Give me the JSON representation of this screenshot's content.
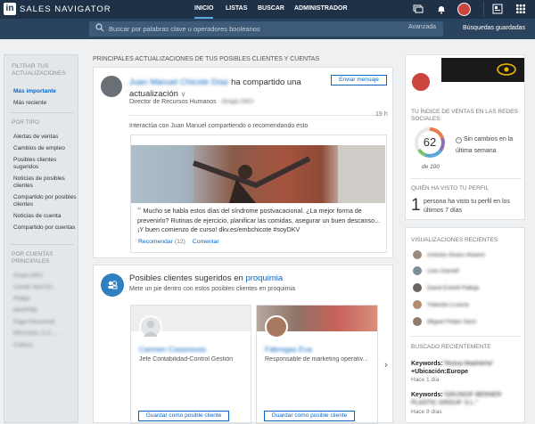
{
  "app": {
    "logo": "in",
    "brand": "SALES NAVIGATOR"
  },
  "nav": [
    {
      "label": "INICIO"
    },
    {
      "label": "LISTAS"
    },
    {
      "label": "BUSCAR"
    },
    {
      "label": "ADMINISTRADOR"
    }
  ],
  "search": {
    "placeholder": "Buscar por palabras clave u operadores booleanos",
    "advanced": "Avanzada",
    "saved": "Búsquedas guardadas"
  },
  "filters": {
    "heading": "FILTRAR TUS ACTUALIZACIONES",
    "sort": [
      "Más importante",
      "Más reciente"
    ],
    "type_heading": "POR TIPO",
    "types": [
      "Alertas de ventas",
      "Cambios de empleo",
      "Posibles clientes sugeridos",
      "Noticias de posibles clientes",
      "Compartido por posibles clientes",
      "Noticias de cuenta",
      "Compartido por cuentas"
    ],
    "accounts_heading": "POR CUENTAS PRINCIPALES",
    "accounts": [
      "Grupo DKV",
      "Condé Nast Es...",
      "Philips",
      "MAPFRE",
      "Page Personnel",
      "PRAXSAL S.C. ...",
      "Collaco"
    ]
  },
  "feed": {
    "title": "PRINCIPALES ACTUALIZACIONES DE TUS POSIBLES CLIENTES Y CUENTAS",
    "post": {
      "name": "Juan Manuel Chicote Díaz",
      "action": "ha compartido una actualización",
      "role": "Director de Recursos Humanos",
      "company": "· Grupo DKV",
      "send": "Enviar mensaje",
      "time": "19 h",
      "prompt": "Interactúa con Juan Manuel compartiendo o recomendando esto",
      "quote": "Mucho se habla estos días del síndrome postvacacional. ¿La mejor forma de prevenirlo? Rutinas de ejercicio, planificar las comidas, asegurar un buen descanso... ¡Y buen comienzo de curso! dkv.es/embchicote #soyDKV",
      "like": "Recomendar",
      "likes": "(12)",
      "comment": "Comentar"
    },
    "suggest": {
      "title": "Posibles clientes sugeridos en",
      "link": "proquimia",
      "subtitle": "Mete un pie dentro con estos posibles clientes en proquimia",
      "leads": [
        {
          "name": "Carmen Casanovas",
          "role": "Jefe Contabilidad-Control Gestión",
          "button": "Guardar como posible cliente"
        },
        {
          "name": "Fàbregas Eva",
          "role": "Responsable de marketing operativ...",
          "button": "Guardar como posible cliente"
        }
      ]
    }
  },
  "right": {
    "ssi_title": "TU ÍNDICE DE VENTAS EN LAS REDES SOCIALES",
    "ssi_score": "62",
    "ssi_of": "de 100",
    "ssi_change": "Sin cambios en la última semana",
    "views_title": "QUIÉN HA VISTO TU PERFIL",
    "views_count": "1",
    "views_text": "persona ha visto tu perfil en los últimos 7 días",
    "recent_title": "VISUALIZACIONES RECIENTES",
    "recent": [
      "Antonio Alvaro Alvarez",
      "Lluis Gamell",
      "David Estivill Palleja",
      "Yolanda LLaona",
      "Miguel Felipe Sanz"
    ],
    "searched_title": "BUSCADO RECIENTEMENTE",
    "searches": [
      {
        "label": "Keywords:",
        "term": "\"Mutua Madrileña\"",
        "extra": "+Ubicación:Europe",
        "when": "Hace 1 día"
      },
      {
        "label": "Keywords:",
        "term": "\"GRUNDIF BERNER PLASTIC GROUP. S.L.\"",
        "extra": "",
        "when": "Hace 9 días"
      }
    ]
  },
  "colors": {
    "topbar": "#1e3147",
    "searchbar": "#2a4460",
    "accent": "#0a66c2",
    "ssi_ring": [
      "#e87d4c",
      "#8e6fb5",
      "#5aa7d8",
      "#7bbf6a"
    ]
  }
}
